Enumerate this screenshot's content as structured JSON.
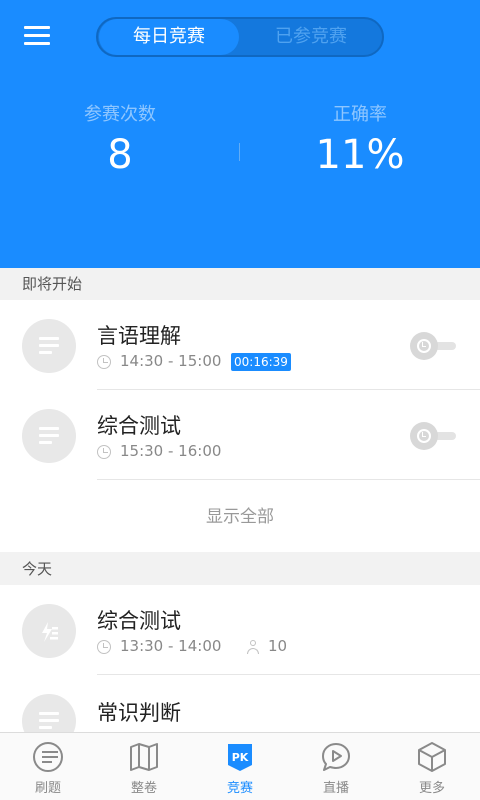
{
  "header": {
    "tabs": [
      {
        "label": "每日竞赛",
        "active": true
      },
      {
        "label": "已参竞赛",
        "active": false
      }
    ],
    "stats": [
      {
        "label": "参赛次数",
        "value": "8"
      },
      {
        "label": "正确率",
        "value": "11%"
      }
    ]
  },
  "upcoming": {
    "title": "即将开始",
    "items": [
      {
        "title": "言语理解",
        "time": "14:30 - 15:00",
        "countdown": "00:16:39"
      },
      {
        "title": "综合测试",
        "time": "15:30 - 16:00"
      }
    ],
    "show_all": "显示全部"
  },
  "today": {
    "title": "今天",
    "items": [
      {
        "title": "综合测试",
        "time": "13:30 - 14:00",
        "participants": "10"
      },
      {
        "title": "常识判断"
      }
    ]
  },
  "tabbar": {
    "items": [
      {
        "label": "刷题",
        "icon": "list-icon"
      },
      {
        "label": "整卷",
        "icon": "map-icon"
      },
      {
        "label": "竞赛",
        "icon": "pk-icon",
        "active": true
      },
      {
        "label": "直播",
        "icon": "live-icon"
      },
      {
        "label": "更多",
        "icon": "cube-icon"
      }
    ]
  },
  "colors": {
    "accent": "#1a8cff",
    "countdown_bg": "#1a8cff"
  }
}
